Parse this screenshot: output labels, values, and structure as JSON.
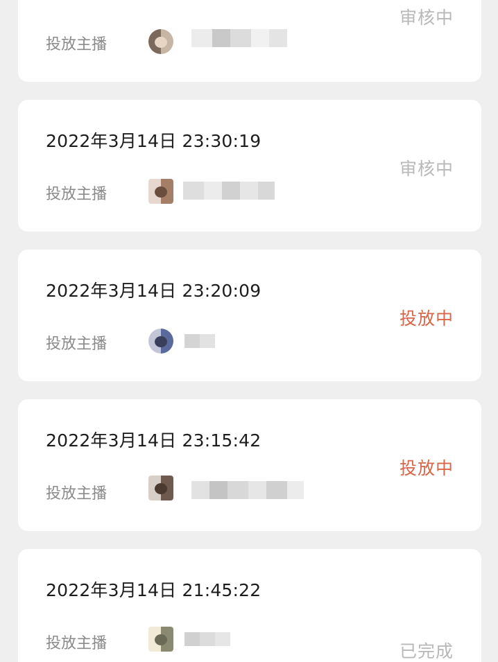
{
  "colors": {
    "background": "#efefef",
    "card": "#ffffff",
    "status_review": "#b8b8b8",
    "status_active": "#d8664a",
    "status_done": "#b8b8b8"
  },
  "orders": [
    {
      "time": "",
      "anchor_label": "投放主播",
      "status": "审核中"
    },
    {
      "time": "2022年3月14日 23:30:19",
      "anchor_label": "投放主播",
      "status": "审核中"
    },
    {
      "time": "2022年3月14日 23:20:09",
      "anchor_label": "投放主播",
      "status": "投放中"
    },
    {
      "time": "2022年3月14日 23:15:42",
      "anchor_label": "投放主播",
      "status": "投放中"
    },
    {
      "time": "2022年3月14日 21:45:22",
      "anchor_label": "投放主播",
      "status": "已完成"
    }
  ]
}
